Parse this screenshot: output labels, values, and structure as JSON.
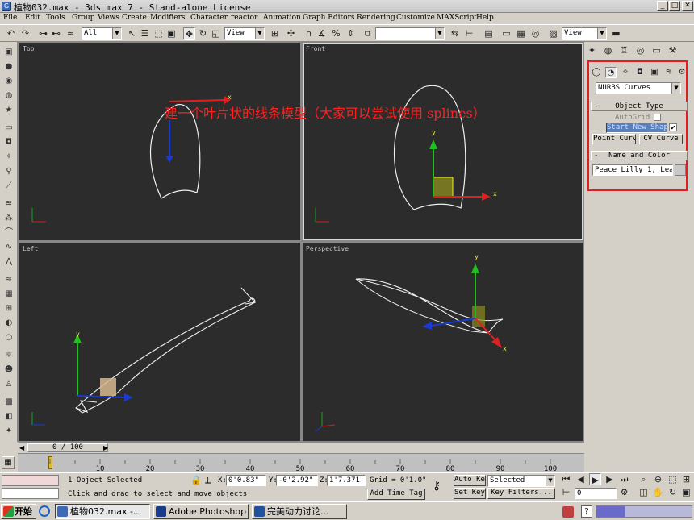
{
  "titlebar": {
    "icon": "3ds-max-icon",
    "title": "植物032.max  - 3ds max 7   - Stand-alone License",
    "buttons": {
      "minimize": "_",
      "maximize": "□",
      "close": "✕"
    }
  },
  "menu": [
    "File",
    "Edit",
    "Tools",
    "Group",
    "Views",
    "Create",
    "Modifiers",
    "Character",
    "reactor",
    "Animation",
    "Graph Editors",
    "Rendering",
    "Customize",
    "MAXScript",
    "Help"
  ],
  "toolbar": {
    "selection_filter": "All",
    "ref_coord": "View",
    "named_selection": "",
    "render_view": "View"
  },
  "overlay_text": "建一个叶片状的线条模型（大家可以尝试使用 splines）",
  "viewports": {
    "top": "Top",
    "front": "Front",
    "left": "Left",
    "perspective": "Perspective",
    "axis_x": "x",
    "axis_y": "y"
  },
  "command_panel": {
    "category_dropdown": "NURBS Curves",
    "object_type_rollout": "Object Type",
    "autogrid_label": "AutoGrid",
    "start_new_shape": "Start New Shape",
    "point_curve": "Point Curve",
    "cv_curve": "CV Curve",
    "name_color_rollout": "Name and Color",
    "object_name": "Peace Lilly 1, Lea",
    "rollout_sign": "-"
  },
  "timeline": {
    "frame_display": "0 / 100",
    "ticks": [
      "10",
      "20",
      "30",
      "40",
      "50",
      "60",
      "70",
      "80",
      "90",
      "100"
    ]
  },
  "status": {
    "selection_info": "1 Object Selected",
    "prompt": "Click and drag to select and move objects",
    "x_label": "X:",
    "x_value": "0'0.83\"",
    "y_label": "Y:",
    "y_value": "-0'2.92\"",
    "z_label": "Z:",
    "z_value": "1'7.371'",
    "grid": "Grid = 0'1.0\"",
    "add_time_tag": "Add Time Tag",
    "auto_key": "Auto Key",
    "auto_key_mode": "Selected",
    "set_key": "Set Key",
    "key_filters": "Key Filters...",
    "current_frame": "0"
  },
  "taskbar": {
    "start": "开始",
    "tasks": [
      {
        "label": "植物032.max -...",
        "icon": "3ds-max-icon"
      },
      {
        "label": "Adobe Photoshop",
        "icon": "photoshop-icon"
      },
      {
        "label": "完美动力讨论...",
        "icon": "browser-icon"
      }
    ]
  }
}
